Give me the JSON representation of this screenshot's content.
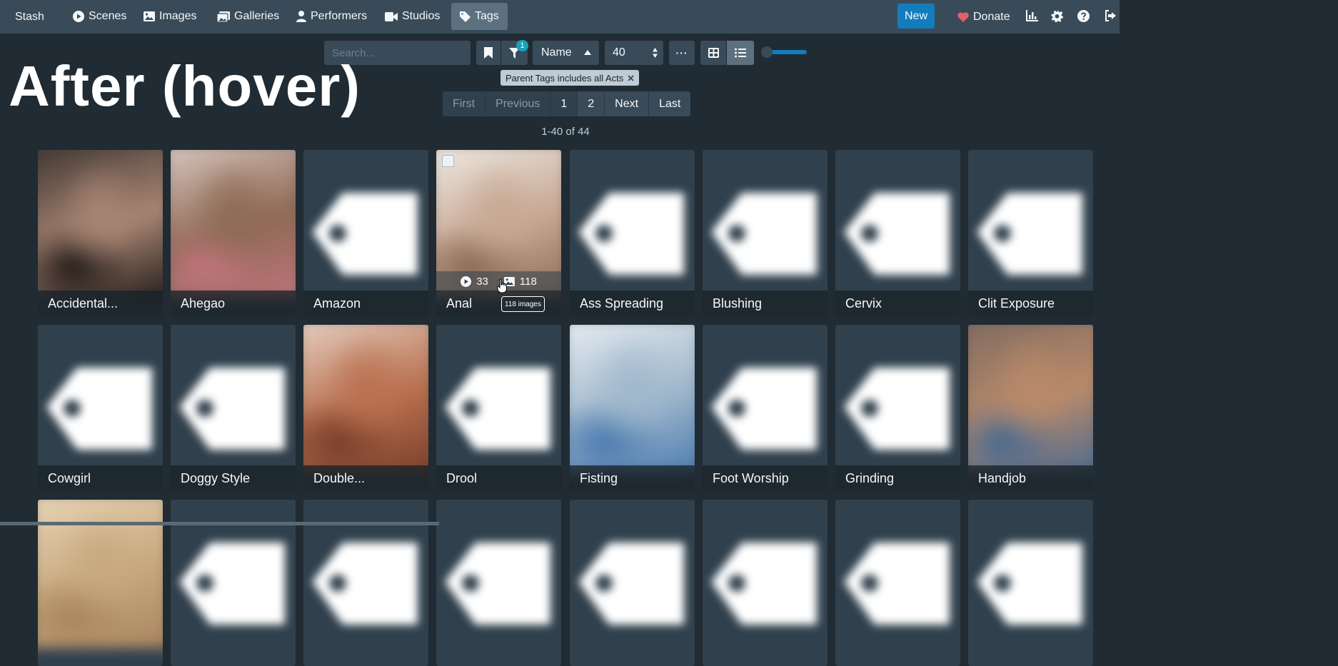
{
  "navbar": {
    "brand": "Stash",
    "items": [
      {
        "label": "Scenes",
        "icon": "play-circle-icon"
      },
      {
        "label": "Images",
        "icon": "image-icon"
      },
      {
        "label": "Galleries",
        "icon": "images-icon"
      },
      {
        "label": "Performers",
        "icon": "user-icon"
      },
      {
        "label": "Studios",
        "icon": "video-icon"
      },
      {
        "label": "Tags",
        "icon": "tag-icon",
        "active": true
      }
    ],
    "new_label": "New",
    "donate_label": "Donate",
    "right_icons": [
      "chart-icon",
      "gear-icon",
      "help-icon",
      "sign-out-icon"
    ]
  },
  "toolbar": {
    "search_placeholder": "Search...",
    "filter_count": "1",
    "sort_by": "Name",
    "per_page": "40",
    "more_label": "···",
    "active_view": "list"
  },
  "filter_chip": {
    "label": "Parent Tags includes all Acts"
  },
  "overlay_title": "After (hover)",
  "pagination": {
    "first": "First",
    "previous": "Previous",
    "pages": [
      "1",
      "2"
    ],
    "current": "1",
    "next": "Next",
    "last": "Last"
  },
  "result_count": "1-40 of 44",
  "tags": [
    {
      "name": "Accidental...",
      "image": "photo",
      "tone": [
        "#3b3330",
        "#a88573",
        "#241d1a"
      ]
    },
    {
      "name": "Ahegao",
      "image": "photo",
      "tone": [
        "#d9c9c2",
        "#8f6a55",
        "#c0747c"
      ]
    },
    {
      "name": "Amazon",
      "image": "default"
    },
    {
      "name": "Anal",
      "image": "photo",
      "tone": [
        "#f0ece7",
        "#c7a892",
        "#8a6b57"
      ],
      "hovered": true,
      "scene_count": "33",
      "image_count": "118",
      "tooltip": "118 images"
    },
    {
      "name": "Ass Spreading",
      "image": "default"
    },
    {
      "name": "Blushing",
      "image": "default"
    },
    {
      "name": "Cervix",
      "image": "default"
    },
    {
      "name": "Clit Exposure",
      "image": "default"
    },
    {
      "name": "Cowgirl",
      "image": "default"
    },
    {
      "name": "Doggy Style",
      "image": "default"
    },
    {
      "name": "Double...",
      "image": "photo",
      "tone": [
        "#e6d2c4",
        "#b9704f",
        "#7a3f2b"
      ]
    },
    {
      "name": "Drool",
      "image": "default"
    },
    {
      "name": "Fisting",
      "image": "photo",
      "tone": [
        "#e9eef2",
        "#a0b8cc",
        "#4c7cb0"
      ]
    },
    {
      "name": "Foot Worship",
      "image": "default"
    },
    {
      "name": "Grinding",
      "image": "default"
    },
    {
      "name": "Handjob",
      "image": "photo",
      "tone": [
        "#7d6a60",
        "#b98a6a",
        "#4a6a90"
      ]
    },
    {
      "name": "",
      "image": "photo",
      "tone": [
        "#e8d6b8",
        "#c8a97e",
        "#a9855e"
      ]
    },
    {
      "name": "",
      "image": "default"
    },
    {
      "name": "",
      "image": "default"
    },
    {
      "name": "",
      "image": "default"
    },
    {
      "name": "",
      "image": "default"
    },
    {
      "name": "",
      "image": "default"
    },
    {
      "name": "",
      "image": "default"
    },
    {
      "name": "",
      "image": "default"
    }
  ]
}
